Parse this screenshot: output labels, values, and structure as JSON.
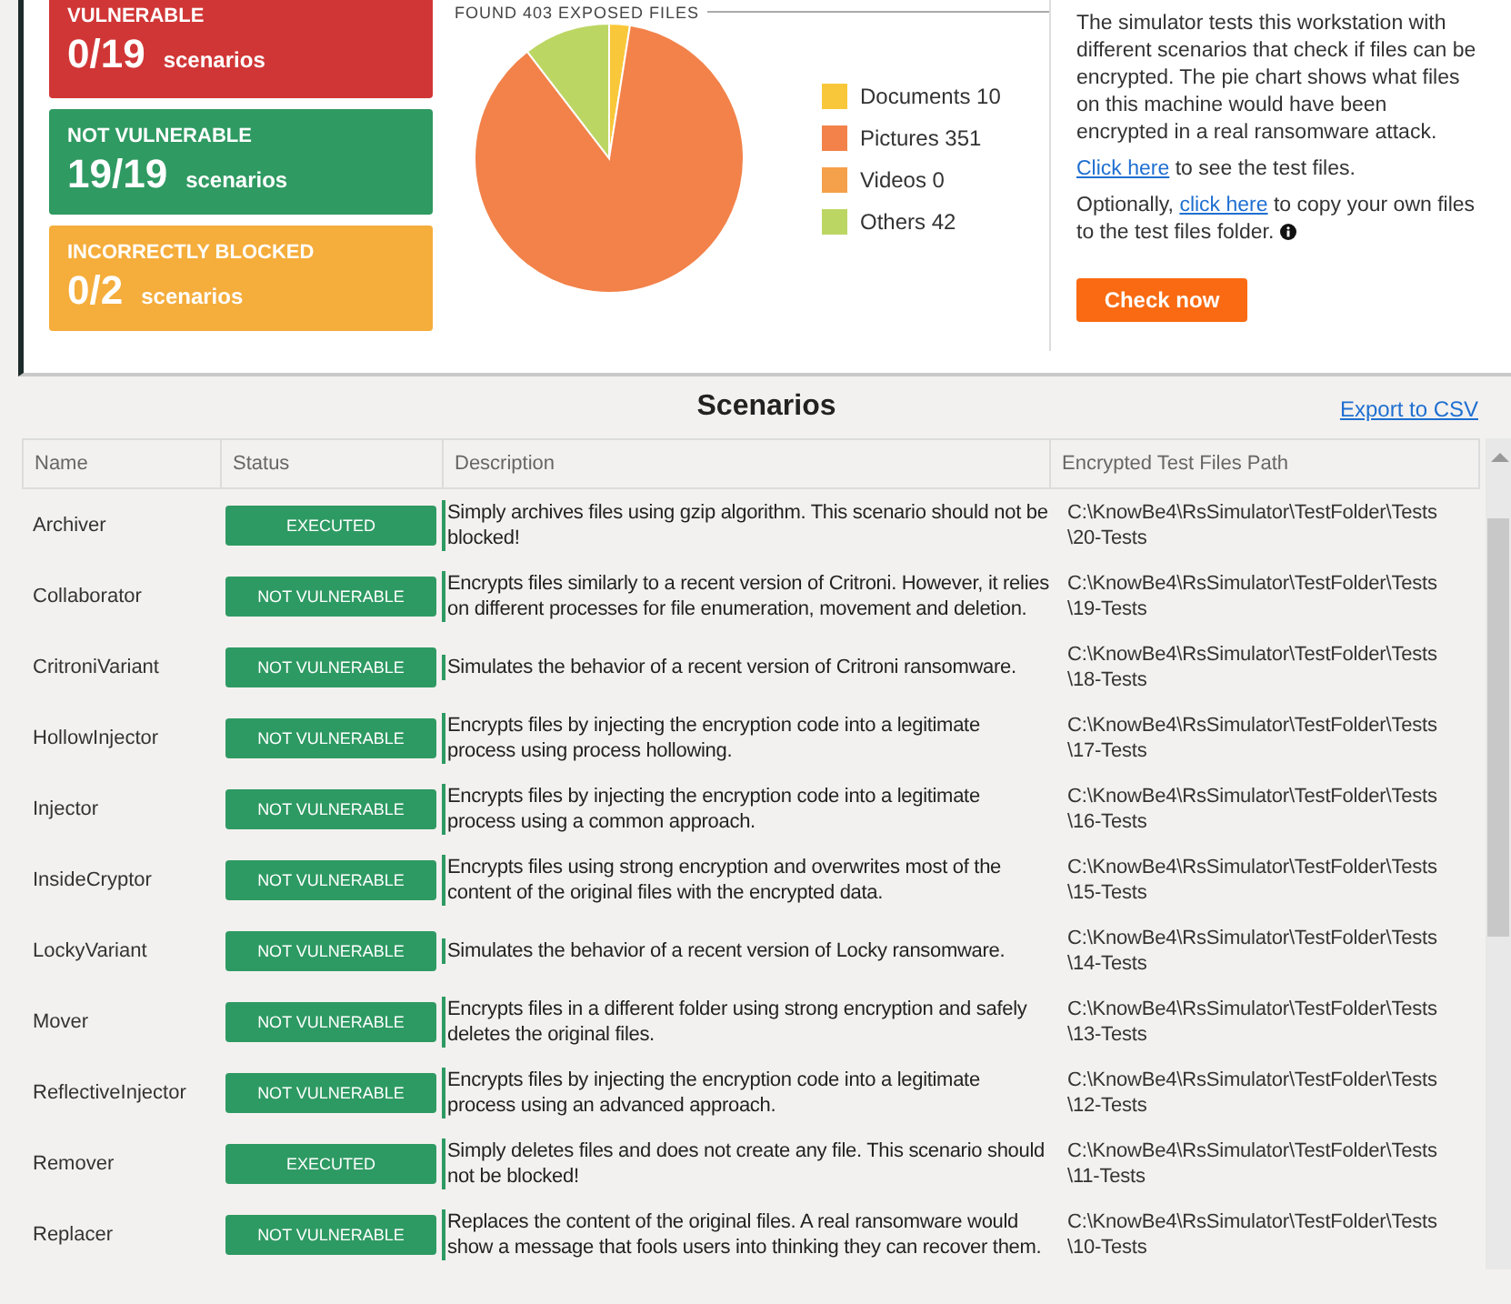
{
  "summary_cards": [
    {
      "kind": "vulnerable",
      "title": "VULNERABLE",
      "count": "0/19",
      "unit": "scenarios"
    },
    {
      "kind": "not_vulnerable",
      "title": "NOT VULNERABLE",
      "count": "19/19",
      "unit": "scenarios"
    },
    {
      "kind": "incorrectly_blocked",
      "title": "INCORRECTLY BLOCKED",
      "count": "0/2",
      "unit": "scenarios"
    }
  ],
  "files_chart": {
    "chart_data": {
      "type": "pie",
      "title": "FOUND 403 EXPOSED FILES",
      "categories": [
        "Documents 10",
        "Pictures 351",
        "Videos 0",
        "Others 42"
      ],
      "series": [
        {
          "values": [
            10,
            351,
            0,
            42
          ]
        }
      ],
      "legend": "right",
      "colors": [
        "#f9c83a",
        "#f2824a",
        "#f5a04a",
        "#bcd663"
      ]
    }
  },
  "info": {
    "text": "The simulator tests this workstation with different scenarios that check if files can be encrypted. The pie chart shows what files on this machine would have been encrypted in a real ransomware attack.",
    "see_files": {
      "link": "Click here",
      "rest": " to see the test files."
    },
    "copy_files": {
      "before": "Optionally, ",
      "link": "click here",
      "rest": " to copy your own files to the test files folder."
    },
    "button": "Check now"
  },
  "scenarios": {
    "title": "Scenarios",
    "export": "Export to CSV",
    "columns": [
      "Name",
      "Status",
      "Description",
      "Encrypted Test Files Path"
    ],
    "rows": [
      {
        "name": "Archiver",
        "status": "EXECUTED",
        "description": "Simply archives files using gzip algorithm. This scenario should not be blocked!",
        "path": "C:\\KnowBe4\\RsSimulator\\TestFolder\\Tests\\20-Tests"
      },
      {
        "name": "Collaborator",
        "status": "NOT VULNERABLE",
        "description": "Encrypts files similarly to a recent version of Critroni. However, it relies on different processes for file enumeration, movement and deletion.",
        "path": "C:\\KnowBe4\\RsSimulator\\TestFolder\\Tests\\19-Tests"
      },
      {
        "name": "CritroniVariant",
        "status": "NOT VULNERABLE",
        "description": "Simulates the behavior of a recent version of Critroni ransomware.",
        "path": "C:\\KnowBe4\\RsSimulator\\TestFolder\\Tests\\18-Tests"
      },
      {
        "name": "HollowInjector",
        "status": "NOT VULNERABLE",
        "description": "Encrypts files by injecting the encryption code into a legitimate process using process hollowing.",
        "path": "C:\\KnowBe4\\RsSimulator\\TestFolder\\Tests\\17-Tests"
      },
      {
        "name": "Injector",
        "status": "NOT VULNERABLE",
        "description": "Encrypts files by injecting the encryption code into a legitimate process using a common approach.",
        "path": "C:\\KnowBe4\\RsSimulator\\TestFolder\\Tests\\16-Tests"
      },
      {
        "name": "InsideCryptor",
        "status": "NOT VULNERABLE",
        "description": "Encrypts files using strong encryption and overwrites most of the content of the original files with the encrypted data.",
        "path": "C:\\KnowBe4\\RsSimulator\\TestFolder\\Tests\\15-Tests"
      },
      {
        "name": "LockyVariant",
        "status": "NOT VULNERABLE",
        "description": "Simulates the behavior of a recent version of Locky ransomware.",
        "path": "C:\\KnowBe4\\RsSimulator\\TestFolder\\Tests\\14-Tests"
      },
      {
        "name": "Mover",
        "status": "NOT VULNERABLE",
        "description": "Encrypts files in a different folder using strong encryption and safely deletes the original files.",
        "path": "C:\\KnowBe4\\RsSimulator\\TestFolder\\Tests\\13-Tests"
      },
      {
        "name": "ReflectiveInjector",
        "status": "NOT VULNERABLE",
        "description": "Encrypts files by injecting the encryption code into a legitimate process using an advanced approach.",
        "path": "C:\\KnowBe4\\RsSimulator\\TestFolder\\Tests\\12-Tests"
      },
      {
        "name": "Remover",
        "status": "EXECUTED",
        "description": "Simply deletes files and does not create any file. This scenario should not be blocked!",
        "path": "C:\\KnowBe4\\RsSimulator\\TestFolder\\Tests\\11-Tests"
      },
      {
        "name": "Replacer",
        "status": "NOT VULNERABLE",
        "description": "Replaces the content of the original files. A real ransomware would show a message that fools users into thinking they can recover them.",
        "path": "C:\\KnowBe4\\RsSimulator\\TestFolder\\Tests\\10-Tests"
      }
    ]
  }
}
